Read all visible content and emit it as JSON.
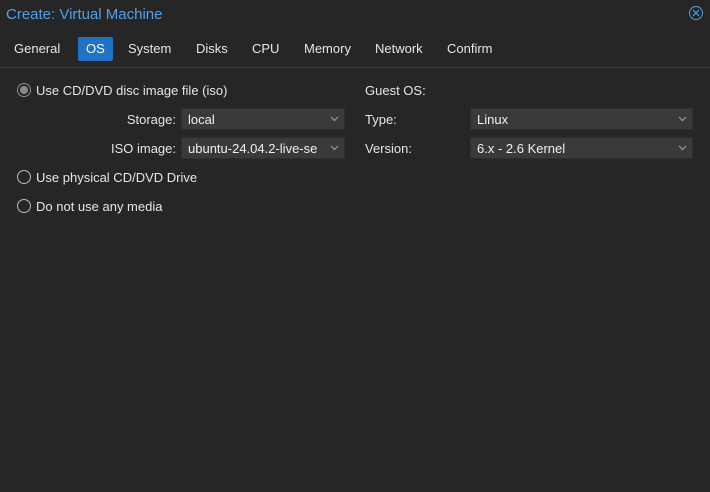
{
  "window": {
    "title": "Create: Virtual Machine"
  },
  "tabs": [
    {
      "label": "General"
    },
    {
      "label": "OS"
    },
    {
      "label": "System"
    },
    {
      "label": "Disks"
    },
    {
      "label": "CPU"
    },
    {
      "label": "Memory"
    },
    {
      "label": "Network"
    },
    {
      "label": "Confirm"
    }
  ],
  "active_tab": "OS",
  "media": {
    "options": [
      {
        "label": "Use CD/DVD disc image file (iso)",
        "selected": true
      },
      {
        "label": "Use physical CD/DVD Drive",
        "selected": false
      },
      {
        "label": "Do not use any media",
        "selected": false
      }
    ],
    "storage": {
      "label": "Storage:",
      "value": "local"
    },
    "iso": {
      "label": "ISO image:",
      "value": "ubuntu-24.04.2-live-se"
    }
  },
  "guest_os": {
    "heading": "Guest OS:",
    "type": {
      "label": "Type:",
      "value": "Linux"
    },
    "version": {
      "label": "Version:",
      "value": "6.x - 2.6 Kernel"
    }
  },
  "colors": {
    "accent": "#1f73c7",
    "title": "#4ea1ea",
    "background": "#262626",
    "field": "#3a3a3a"
  },
  "icons": {
    "close": "close-circle-icon",
    "dropdown": "chevron-down-icon"
  }
}
